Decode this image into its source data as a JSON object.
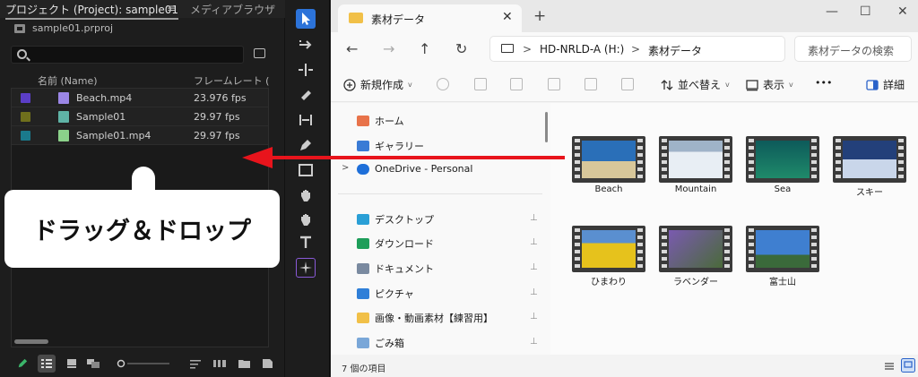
{
  "project": {
    "tab_title": "プロジェクト (Project): sample01",
    "tab_menu": "≡",
    "media_tab": "メディアブラウザ",
    "file": "sample01.prproj",
    "col_name": "名前 (Name)",
    "col_fps": "フレームレート (F",
    "items": [
      {
        "name": "Beach.mp4",
        "fps": "23.976 fps",
        "label_color": "#5b3ec7",
        "icon_color": "#9b86e6"
      },
      {
        "name": "Sample01",
        "fps": "29.97 fps",
        "label_color": "#6f6f1c",
        "icon_color": "#5fb3a6"
      },
      {
        "name": "Sample01.mp4",
        "fps": "29.97 fps",
        "label_color": "#1a7a8c",
        "icon_color": "#8bd18a"
      }
    ]
  },
  "bubble": {
    "text": "ドラッグ＆ドロップ"
  },
  "explorer": {
    "tab_title": "素材データ",
    "tab_close": "✕",
    "new_tab": "+",
    "win_min": "—",
    "win_max": "☐",
    "win_close": "✕",
    "nav_back": "←",
    "nav_forward": "→",
    "nav_up": "↑",
    "nav_refresh": "↻",
    "path": [
      "HD-NRLD-A (H:)",
      "素材データ"
    ],
    "path_sep": ">",
    "search_placeholder": "素材データの検索",
    "cmd": {
      "new": "新規作成",
      "sort": "並べ替え",
      "view": "表示",
      "more": "•••",
      "details": "詳細"
    },
    "sidebar": [
      {
        "label": "ホーム",
        "color": "#e8734a",
        "pinned": false
      },
      {
        "label": "ギャラリー",
        "color": "#3a7bd5",
        "pinned": false
      },
      {
        "label": "OneDrive - Personal",
        "color": "#1e6fd9",
        "pinned": false
      },
      {
        "label": "デスクトップ",
        "color": "#2a9fd6",
        "pinned": true
      },
      {
        "label": "ダウンロード",
        "color": "#1e9e5a",
        "pinned": true
      },
      {
        "label": "ドキュメント",
        "color": "#7a8aa0",
        "pinned": true
      },
      {
        "label": "ピクチャ",
        "color": "#2f7fd8",
        "pinned": true
      },
      {
        "label": "画像・動画素材【練習用】",
        "color": "#f1c048",
        "pinned": true
      },
      {
        "label": "ごみ箱",
        "color": "#7aa7d8",
        "pinned": true
      }
    ],
    "pin_glyph": "📌",
    "files": [
      {
        "name": "Beach",
        "c1": "#2a6fb8",
        "c2": "#d8c79a"
      },
      {
        "name": "Mountain",
        "c1": "#9fb3c8",
        "c2": "#e8eef4"
      },
      {
        "name": "Sea",
        "c1": "#0d5a5a",
        "c2": "#1f8a6a"
      },
      {
        "name": "スキー",
        "c1": "#23407a",
        "c2": "#c9d6ea"
      },
      {
        "name": "ひまわり",
        "c1": "#5a8fd0",
        "c2": "#e6c21c"
      },
      {
        "name": "ラベンダー",
        "c1": "#7a5ab0",
        "c2": "#4a6a3a"
      },
      {
        "name": "富士山",
        "c1": "#3f7fd0",
        "c2": "#3a6a3a"
      }
    ],
    "status": "7 個の項目"
  },
  "colors": {
    "arrow": "#e8141c"
  }
}
